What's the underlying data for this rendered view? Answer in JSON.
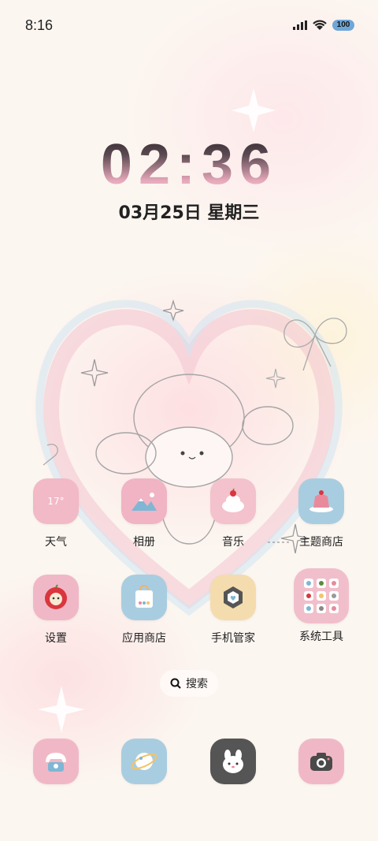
{
  "status_bar": {
    "time": "8:16",
    "battery": "100"
  },
  "lock_clock": {
    "time": "02:36",
    "date": "03月25日 星期三"
  },
  "apps": [
    {
      "label": "天气",
      "icon": "weather-icon",
      "icon_text": "17°",
      "color": "#f2b9c6"
    },
    {
      "label": "相册",
      "icon": "gallery-icon",
      "color": "#f0b4c4"
    },
    {
      "label": "音乐",
      "icon": "music-icon",
      "color": "#f3c2cc"
    },
    {
      "label": "主题商店",
      "icon": "theme-store-icon",
      "color": "#a9cde0"
    },
    {
      "label": "设置",
      "icon": "settings-icon",
      "color": "#f0b8c6"
    },
    {
      "label": "应用商店",
      "icon": "app-store-icon",
      "color": "#a9cde0"
    },
    {
      "label": "手机管家",
      "icon": "phone-manager-icon",
      "color": "#f4dcae"
    },
    {
      "label": "系统工具",
      "icon": "system-tools-icon",
      "color": "#f1bfcb"
    }
  ],
  "search": {
    "label": "搜索"
  },
  "dock": [
    {
      "icon": "phone-icon",
      "color": "#f0b8c6"
    },
    {
      "icon": "browser-icon",
      "color": "#a9cde0"
    },
    {
      "icon": "messages-icon",
      "color": "#555555"
    },
    {
      "icon": "camera-icon",
      "color": "#f0b8c6"
    }
  ]
}
